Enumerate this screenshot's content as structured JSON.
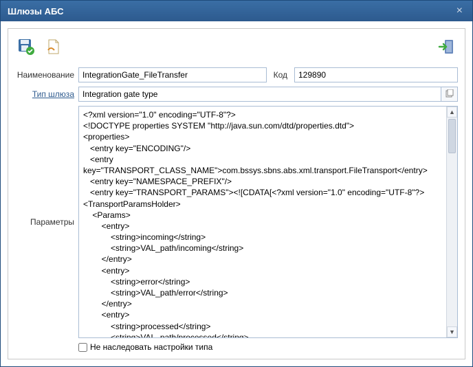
{
  "window": {
    "title": "Шлюзы АБС"
  },
  "labels": {
    "name": "Наименование",
    "code": "Код",
    "type": "Тип шлюза",
    "params": "Параметры",
    "dont_inherit": "Не наследовать настройки типа"
  },
  "fields": {
    "name_value": "IntegrationGate_FileTransfer",
    "code_value": "129890",
    "type_value": "Integration gate type",
    "params_value": "<?xml version=\"1.0\" encoding=\"UTF-8\"?>\n<!DOCTYPE properties SYSTEM \"http://java.sun.com/dtd/properties.dtd\">\n<properties>\n   <entry key=\"ENCODING\"/>\n   <entry\nkey=\"TRANSPORT_CLASS_NAME\">com.bssys.sbns.abs.xml.transport.FileTransport</entry>\n   <entry key=\"NAMESPACE_PREFIX\"/>\n   <entry key=\"TRANSPORT_PARAMS\"><![CDATA[<?xml version=\"1.0\" encoding=\"UTF-8\"?>\n<TransportParamsHolder>\n    <Params>\n        <entry>\n            <string>incoming</string>\n            <string>VAL_path/incoming</string>\n        </entry>\n        <entry>\n            <string>error</string>\n            <string>VAL_path/error</string>\n        </entry>\n        <entry>\n            <string>processed</string>\n            <string>VAL_path/processed</string>\n        </entry>\n        <entry>"
  },
  "icons": {
    "save": "save-ok-icon",
    "doc": "document-icon",
    "exit": "exit-icon",
    "copy": "copy-icon"
  }
}
